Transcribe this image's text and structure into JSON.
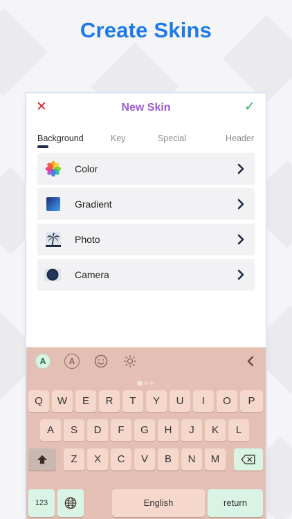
{
  "hero": {
    "title": "Create Skins"
  },
  "nav": {
    "title": "New Skin",
    "close_icon": "close-icon",
    "confirm_icon": "checkmark-icon"
  },
  "tabs": [
    {
      "label": "Background",
      "active": true
    },
    {
      "label": "Key",
      "active": false
    },
    {
      "label": "Special",
      "active": false
    },
    {
      "label": "Header",
      "active": false
    }
  ],
  "menu": [
    {
      "label": "Color",
      "icon": "color-petals-icon"
    },
    {
      "label": "Gradient",
      "icon": "gradient-square-icon"
    },
    {
      "label": "Photo",
      "icon": "palm-tree-photo-icon"
    },
    {
      "label": "Camera",
      "icon": "camera-icon"
    }
  ],
  "keyboard": {
    "background": "#e3bfb4",
    "toolbar": {
      "font_style_badge": "A",
      "font_style_outline": "A"
    },
    "row1": [
      "Q",
      "W",
      "E",
      "R",
      "T",
      "Y",
      "U",
      "I",
      "O",
      "P"
    ],
    "row2": [
      "A",
      "S",
      "D",
      "F",
      "G",
      "H",
      "J",
      "K",
      "L"
    ],
    "row3": [
      "Z",
      "X",
      "C",
      "V",
      "B",
      "N",
      "M"
    ],
    "numbers_key": "123",
    "space_key": "English",
    "return_key": "return"
  },
  "colors": {
    "hero_blue": "#1f7ae8",
    "title_purple": "#9b59d6",
    "close_red": "#e02424",
    "confirm_green": "#2cae5f",
    "key_fill": "#f6d7cb",
    "accent_key_fill": "#d9f4e4"
  }
}
